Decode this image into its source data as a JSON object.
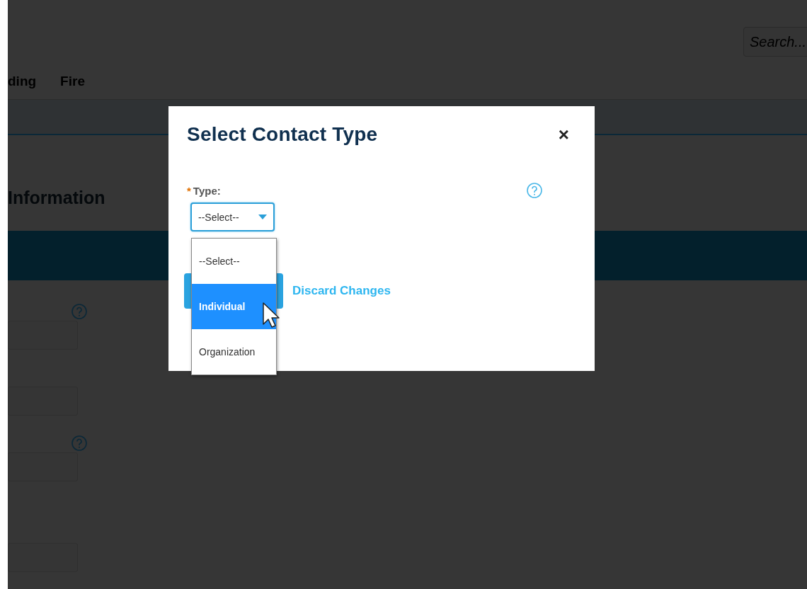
{
  "page": {
    "search": {
      "placeholder": "Search..."
    },
    "nav": [
      {
        "label": "ding"
      },
      {
        "label": "Fire"
      }
    ],
    "section_title": "Information",
    "fields": [
      {
        "help": true
      },
      {
        "help": false
      },
      {
        "help": true
      },
      {
        "help": false
      }
    ]
  },
  "dialog": {
    "title": "Select Contact Type",
    "close": "×",
    "field": {
      "required_mark": "*",
      "label": "Type:",
      "value": "--Select--",
      "focused": true,
      "help": true
    },
    "options": [
      {
        "label": "--Select--",
        "selected": false
      },
      {
        "label": "Individual",
        "selected": true
      },
      {
        "label": "Organization",
        "selected": false
      }
    ],
    "discard_link": "Discard Changes"
  }
}
